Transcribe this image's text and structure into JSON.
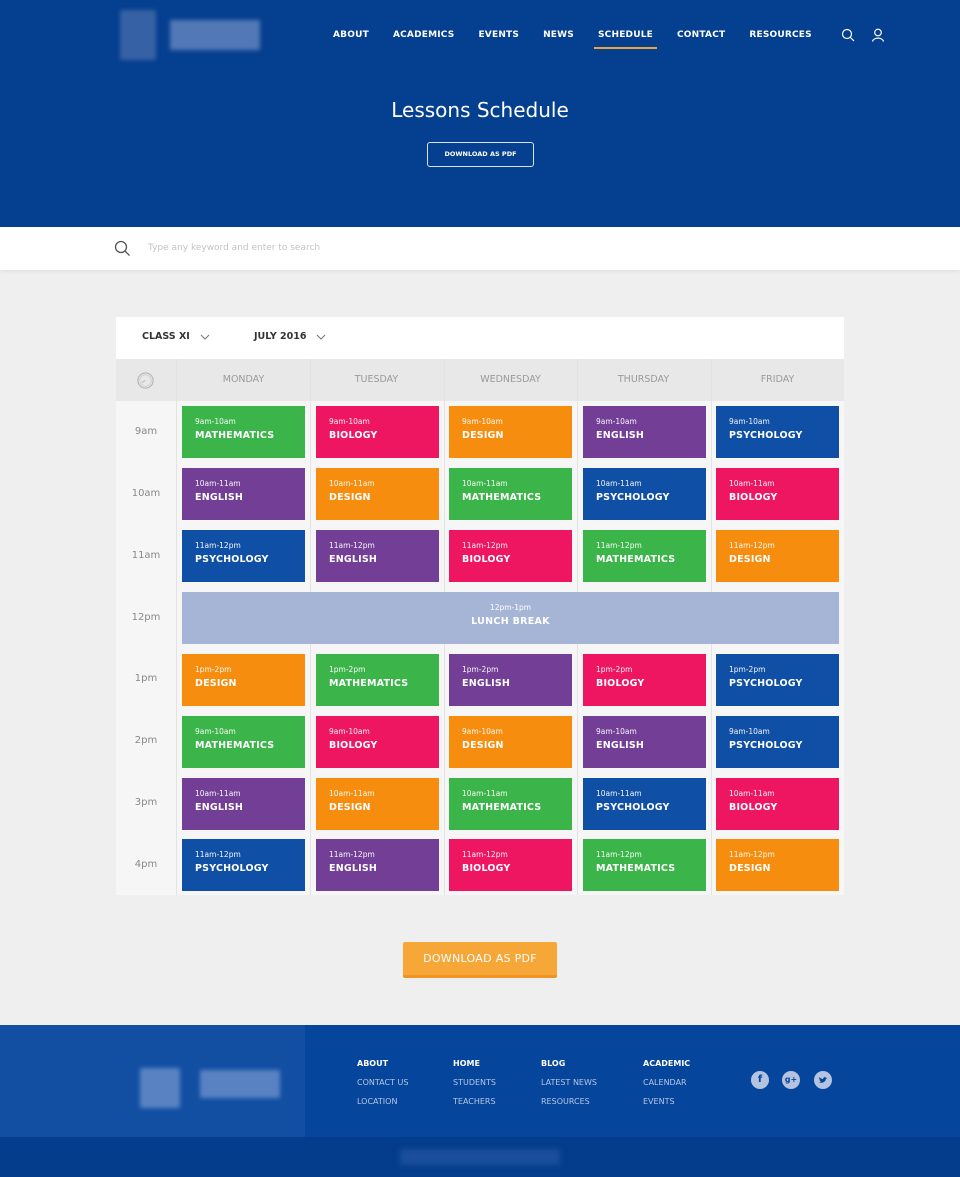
{
  "header": {
    "logo_alt": "School logo (blurred)",
    "nav": [
      {
        "label": "ABOUT",
        "active": false
      },
      {
        "label": "ACADEMICS",
        "active": false
      },
      {
        "label": "EVENTS",
        "active": false
      },
      {
        "label": "NEWS",
        "active": false
      },
      {
        "label": "SCHEDULE",
        "active": true
      },
      {
        "label": "CONTACT",
        "active": false
      },
      {
        "label": "RESOURCES",
        "active": false
      }
    ],
    "icons": [
      "search-icon",
      "user-icon"
    ],
    "title": "Lessons Schedule",
    "download_label": "DOWNLOAD AS PDF"
  },
  "search": {
    "placeholder": "Type any keyword and enter to search",
    "value": ""
  },
  "filters": {
    "class": "CLASS XI",
    "month": "JULY 2016"
  },
  "schedule": {
    "days": [
      "MONDAY",
      "TUESDAY",
      "WEDNESDAY",
      "THURSDAY",
      "FRIDAY"
    ],
    "times": [
      "9am",
      "10am",
      "11am",
      "12pm",
      "1pm",
      "2pm",
      "3pm",
      "4pm"
    ],
    "colors": {
      "MATHEMATICS": "#3bb54a",
      "BIOLOGY": "#ee1661",
      "DESIGN": "#f68d0e",
      "ENGLISH": "#733f96",
      "PSYCHOLOGY": "#0f4fa5",
      "LUNCH": "#a6b5d6"
    },
    "rows": [
      [
        {
          "time": "9am-10am",
          "subject": "MATHEMATICS"
        },
        {
          "time": "9am-10am",
          "subject": "BIOLOGY"
        },
        {
          "time": "9am-10am",
          "subject": "DESIGN"
        },
        {
          "time": "9am-10am",
          "subject": "ENGLISH"
        },
        {
          "time": "9am-10am",
          "subject": "PSYCHOLOGY"
        }
      ],
      [
        {
          "time": "10am-11am",
          "subject": "ENGLISH"
        },
        {
          "time": "10am-11am",
          "subject": "DESIGN"
        },
        {
          "time": "10am-11am",
          "subject": "MATHEMATICS"
        },
        {
          "time": "10am-11am",
          "subject": "PSYCHOLOGY"
        },
        {
          "time": "10am-11am",
          "subject": "BIOLOGY"
        }
      ],
      [
        {
          "time": "11am-12pm",
          "subject": "PSYCHOLOGY"
        },
        {
          "time": "11am-12pm",
          "subject": "ENGLISH"
        },
        {
          "time": "11am-12pm",
          "subject": "BIOLOGY"
        },
        {
          "time": "11am-12pm",
          "subject": "MATHEMATICS"
        },
        {
          "time": "11am-12pm",
          "subject": "DESIGN"
        }
      ],
      null,
      [
        {
          "time": "1pm-2pm",
          "subject": "DESIGN"
        },
        {
          "time": "1pm-2pm",
          "subject": "MATHEMATICS"
        },
        {
          "time": "1pm-2pm",
          "subject": "ENGLISH"
        },
        {
          "time": "1pm-2pm",
          "subject": "BIOLOGY"
        },
        {
          "time": "1pm-2pm",
          "subject": "PSYCHOLOGY"
        }
      ],
      [
        {
          "time": "9am-10am",
          "subject": "MATHEMATICS"
        },
        {
          "time": "9am-10am",
          "subject": "BIOLOGY"
        },
        {
          "time": "9am-10am",
          "subject": "DESIGN"
        },
        {
          "time": "9am-10am",
          "subject": "ENGLISH"
        },
        {
          "time": "9am-10am",
          "subject": "PSYCHOLOGY"
        }
      ],
      [
        {
          "time": "10am-11am",
          "subject": "ENGLISH"
        },
        {
          "time": "10am-11am",
          "subject": "DESIGN"
        },
        {
          "time": "10am-11am",
          "subject": "MATHEMATICS"
        },
        {
          "time": "10am-11am",
          "subject": "PSYCHOLOGY"
        },
        {
          "time": "10am-11am",
          "subject": "BIOLOGY"
        }
      ],
      [
        {
          "time": "11am-12pm",
          "subject": "PSYCHOLOGY"
        },
        {
          "time": "11am-12pm",
          "subject": "ENGLISH"
        },
        {
          "time": "11am-12pm",
          "subject": "BIOLOGY"
        },
        {
          "time": "11am-12pm",
          "subject": "MATHEMATICS"
        },
        {
          "time": "11am-12pm",
          "subject": "DESIGN"
        }
      ]
    ],
    "lunch": {
      "time": "12pm-1pm",
      "label": "LUNCH BREAK"
    }
  },
  "download_button": "DOWNLOAD AS PDF",
  "footer": {
    "columns": [
      {
        "heading": "ABOUT",
        "links": [
          "CONTACT US",
          "LOCATION"
        ]
      },
      {
        "heading": "HOME",
        "links": [
          "STUDENTS",
          "TEACHERS"
        ]
      },
      {
        "heading": "BLOG",
        "links": [
          "LATEST NEWS",
          "RESOURCES"
        ]
      },
      {
        "heading": "ACADEMIC",
        "links": [
          "CALENDAR",
          "EVENTS"
        ]
      }
    ],
    "social": [
      {
        "name": "facebook-icon",
        "glyph": "f"
      },
      {
        "name": "google-plus-icon",
        "glyph": "g+"
      },
      {
        "name": "twitter-icon",
        "glyph": "t"
      }
    ]
  }
}
